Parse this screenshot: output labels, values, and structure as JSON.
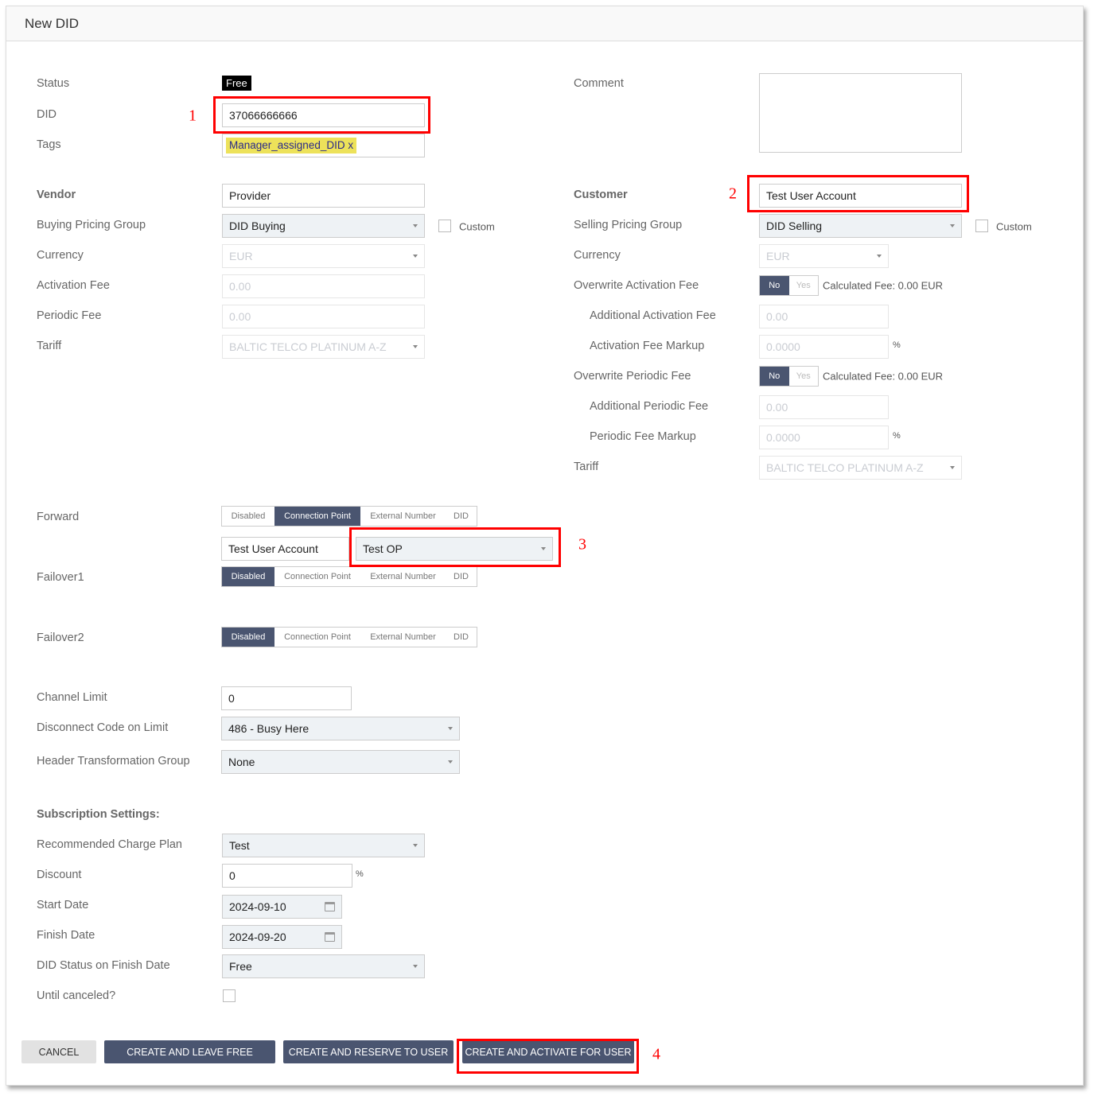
{
  "title": "New DID",
  "left": {
    "status_label": "Status",
    "status_value": "Free",
    "did_label": "DID",
    "did_value": "37066666666",
    "tags_label": "Tags",
    "tag": "Manager_assigned_DID",
    "tag_remove": "x",
    "vendor_label": "Vendor",
    "vendor_value": "Provider",
    "buying_label": "Buying Pricing Group",
    "buying_value": "DID Buying",
    "custom_label": "Custom",
    "currency_label": "Currency",
    "currency_value": "EUR",
    "activation_label": "Activation Fee",
    "activation_value": "0.00",
    "periodic_label": "Periodic Fee",
    "periodic_value": "0.00",
    "tariff_label": "Tariff",
    "tariff_value": "BALTIC TELCO PLATINUM A-Z"
  },
  "right": {
    "comment_label": "Comment",
    "comment_value": "",
    "customer_label": "Customer",
    "customer_value": "Test User Account",
    "selling_label": "Selling Pricing Group",
    "selling_value": "DID Selling",
    "custom_label": "Custom",
    "currency_label": "Currency",
    "currency_value": "EUR",
    "ow_act_label": "Overwrite Activation Fee",
    "no": "No",
    "yes": "Yes",
    "calc_act": "Calculated Fee: 0.00 EUR",
    "add_act_label": "Additional Activation Fee",
    "add_act_value": "0.00",
    "act_markup_label": "Activation Fee Markup",
    "act_markup_value": "0.0000",
    "percent": "%",
    "ow_per_label": "Overwrite Periodic Fee",
    "calc_per": "Calculated Fee: 0.00 EUR",
    "add_per_label": "Additional Periodic Fee",
    "add_per_value": "0.00",
    "per_markup_label": "Periodic Fee Markup",
    "per_markup_value": "0.0000",
    "tariff_label": "Tariff",
    "tariff_value": "BALTIC TELCO PLATINUM A-Z"
  },
  "routing": {
    "options": [
      "Disabled",
      "Connection Point",
      "External Number",
      "DID"
    ],
    "forward_label": "Forward",
    "forward_selected": "Connection Point",
    "forward_account": "Test User Account",
    "forward_cp": "Test OP",
    "failover1_label": "Failover1",
    "failover1_selected": "Disabled",
    "failover2_label": "Failover2",
    "failover2_selected": "Disabled"
  },
  "limits": {
    "channel_label": "Channel Limit",
    "channel_value": "0",
    "disconnect_label": "Disconnect Code on Limit",
    "disconnect_value": "486 - Busy Here",
    "header_label": "Header Transformation Group",
    "header_value": "None"
  },
  "subscription": {
    "title": "Subscription Settings:",
    "plan_label": "Recommended Charge Plan",
    "plan_value": "Test",
    "discount_label": "Discount",
    "discount_value": "0",
    "percent": "%",
    "start_label": "Start Date",
    "start_value": "2024-09-10",
    "finish_label": "Finish Date",
    "finish_value": "2024-09-20",
    "status_label": "DID Status on Finish Date",
    "status_value": "Free",
    "until_label": "Until canceled?",
    "until_checked": false
  },
  "buttons": {
    "cancel": "CANCEL",
    "leave_free": "CREATE AND LEAVE FREE",
    "reserve": "CREATE AND RESERVE TO USER",
    "activate": "CREATE AND ACTIVATE FOR USER"
  },
  "annotations": [
    "1",
    "2",
    "3",
    "4"
  ],
  "colors": {
    "accent": "#4a5570",
    "highlight": "#ff0000",
    "tag": "#ede25a"
  }
}
